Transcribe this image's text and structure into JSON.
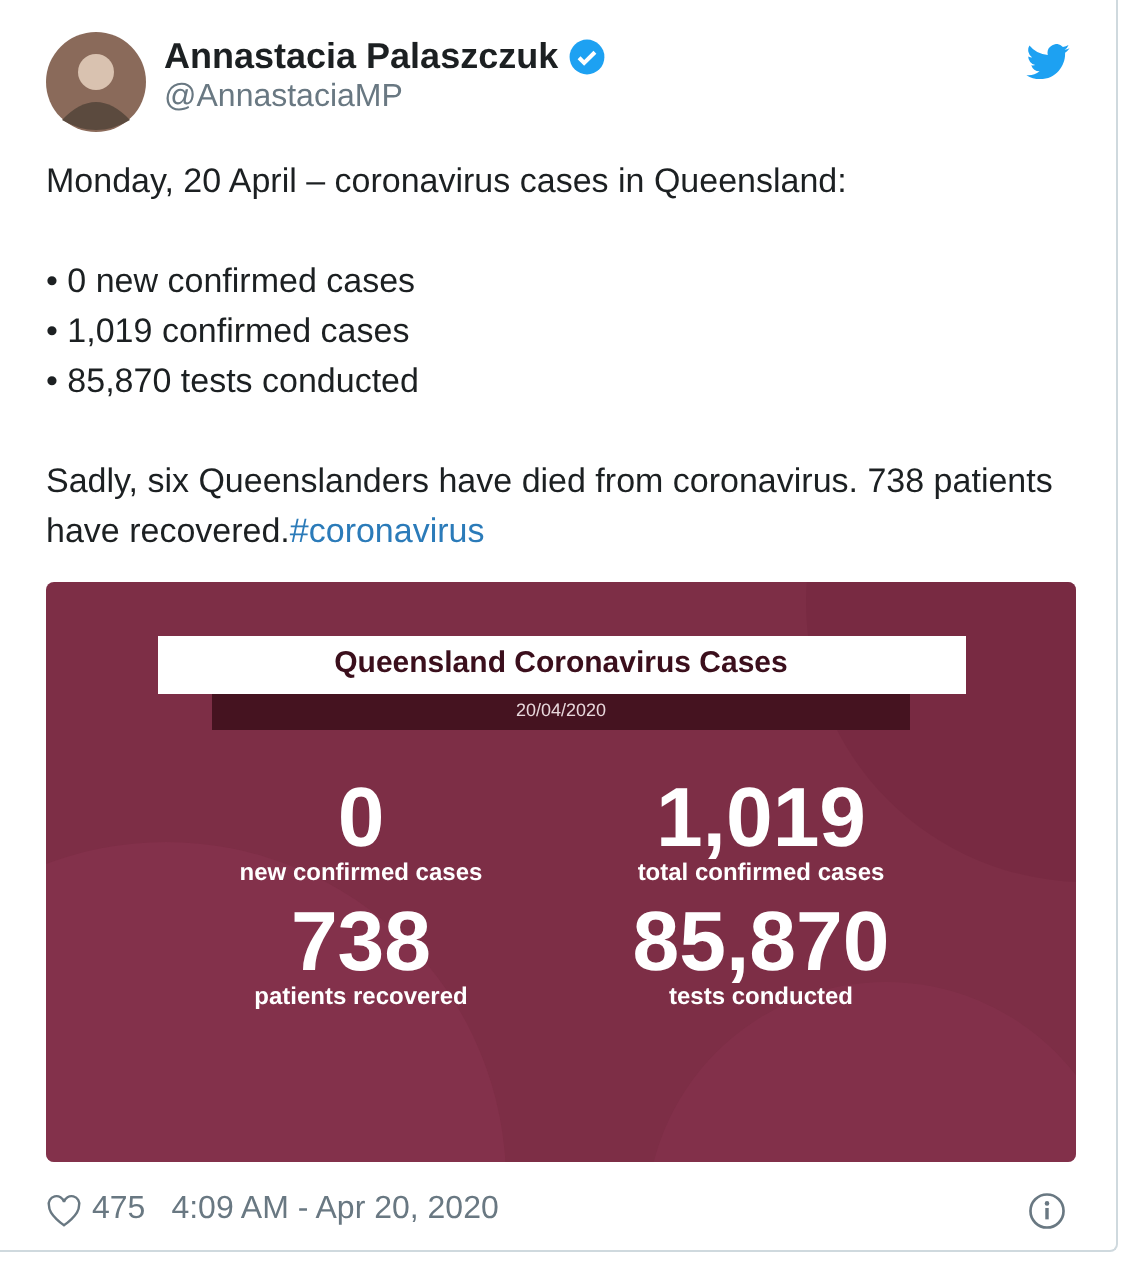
{
  "author": {
    "name": "Annastacia Palaszczuk",
    "verified": true,
    "handle": "@AnnastaciaMP"
  },
  "body": {
    "intro": "Monday, 20 April – coronavirus cases in Queensland:",
    "bullets": [
      "• 0 new confirmed cases",
      "• 1,019 confirmed cases",
      "• 85,870 tests conducted"
    ],
    "closing": "Sadly, six Queenslanders have died from coronavirus. 738 patients have recovered.",
    "hashtag": "#coronavirus"
  },
  "infographic": {
    "title": "Queensland Coronavirus Cases",
    "date": "20/04/2020",
    "stats": [
      {
        "value": "0",
        "label": "new confirmed cases"
      },
      {
        "value": "1,019",
        "label": "total confirmed cases"
      },
      {
        "value": "738",
        "label": "patients recovered"
      },
      {
        "value": "85,870",
        "label": "tests conducted"
      }
    ]
  },
  "footer": {
    "likes": "475",
    "timestamp": "4:09 AM - Apr 20, 2020"
  }
}
